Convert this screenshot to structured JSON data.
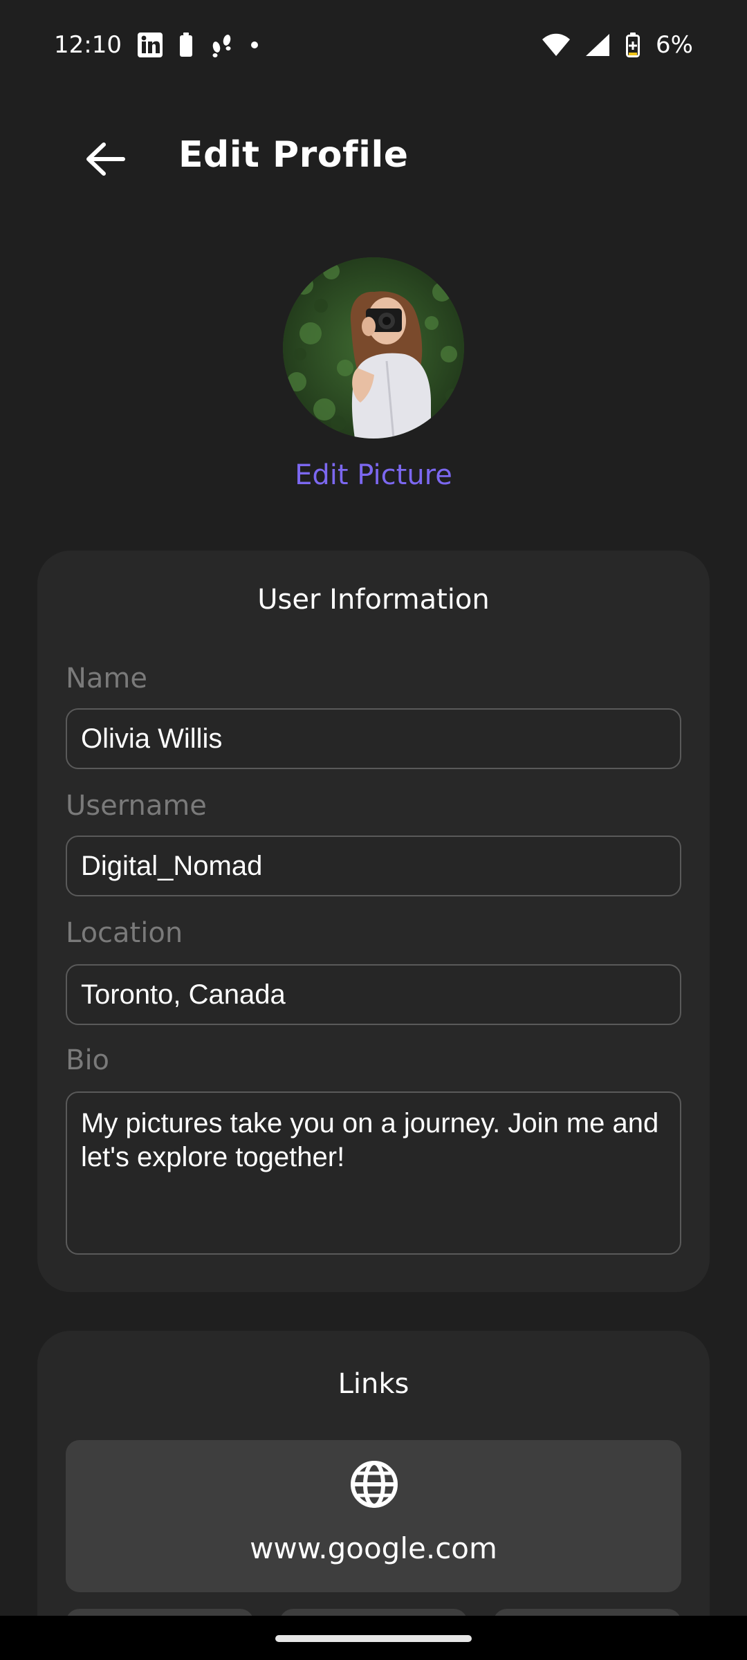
{
  "status_bar": {
    "time": "12:10",
    "battery_percent": "6%",
    "icons": [
      "linkedin-icon",
      "battery-saver-icon",
      "steps-icon",
      "dot-icon",
      "wifi-icon",
      "signal-icon",
      "battery-icon"
    ]
  },
  "header": {
    "title": "Edit Profile",
    "back_icon": "arrow-back-icon"
  },
  "profile": {
    "edit_picture_label": "Edit Picture",
    "accent_color": "#7c68f0"
  },
  "user_info": {
    "title": "User Information",
    "fields": [
      {
        "label": "Name",
        "value": "Olivia Willis"
      },
      {
        "label": "Username",
        "value": "Digital_Nomad"
      },
      {
        "label": "Location",
        "value": "Toronto, Canada"
      },
      {
        "label": "Bio",
        "value": "My pictures take you on a journey. Join me and let's explore together!"
      }
    ]
  },
  "links": {
    "title": "Links",
    "items": [
      {
        "icon": "globe-icon",
        "url": "www.google.com"
      }
    ]
  }
}
